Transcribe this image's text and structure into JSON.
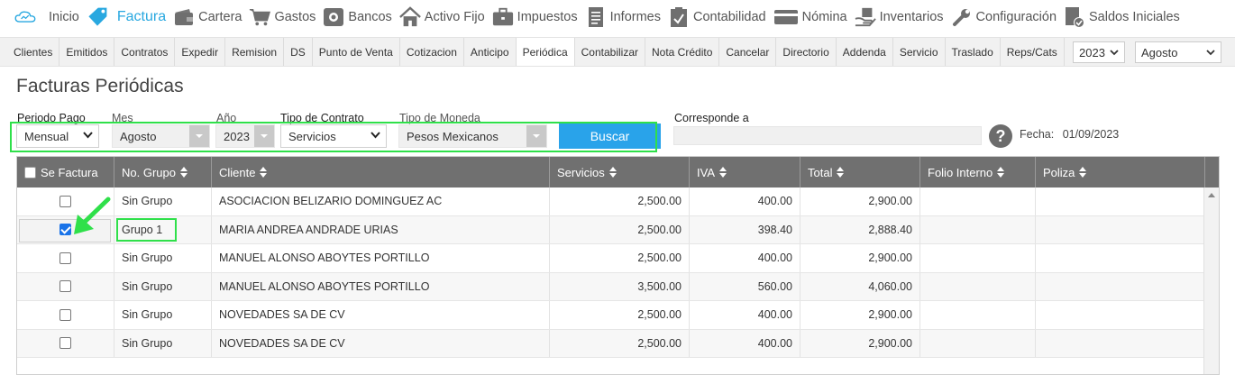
{
  "topnav": {
    "items": [
      {
        "label": "Inicio",
        "icon": "cloud-icon"
      },
      {
        "label": "Factura",
        "icon": "tag-icon"
      },
      {
        "label": "Cartera",
        "icon": "wallet-icon"
      },
      {
        "label": "Gastos",
        "icon": "cart-icon"
      },
      {
        "label": "Bancos",
        "icon": "bank-icon"
      },
      {
        "label": "Activo Fijo",
        "icon": "house-icon"
      },
      {
        "label": "Impuestos",
        "icon": "briefcase-icon"
      },
      {
        "label": "Informes",
        "icon": "document-icon"
      },
      {
        "label": "Contabilidad",
        "icon": "clipboard-check-icon"
      },
      {
        "label": "Nómina",
        "icon": "card-icon"
      },
      {
        "label": "Inventarios",
        "icon": "hand-box-icon"
      },
      {
        "label": "Configuración",
        "icon": "wrench-icon"
      },
      {
        "label": "Saldos Iniciales",
        "icon": "document-check-icon"
      }
    ],
    "active_index": 1
  },
  "subnav": {
    "tabs": [
      "Clientes",
      "Emitidos",
      "Contratos",
      "Expedir",
      "Remision",
      "DS",
      "Punto de Venta",
      "Cotizacion",
      "Anticipo",
      "Periódica",
      "Contabilizar",
      "Nota Crédito",
      "Cancelar",
      "Directorio",
      "Addenda",
      "Servicio",
      "Traslado",
      "Reps/Cats"
    ],
    "active_index": 9,
    "year": "2023",
    "month": "Agosto"
  },
  "page_title": "Facturas Periódicas",
  "filters": {
    "periodo_pago": {
      "label": "Periodo Pago",
      "value": "Mensual"
    },
    "mes": {
      "label": "Mes",
      "value": "Agosto"
    },
    "anio": {
      "label": "Año",
      "value": "2023"
    },
    "tipo_contrato": {
      "label": "Tipo de Contrato",
      "value": "Servicios"
    },
    "tipo_moneda": {
      "label": "Tipo de Moneda",
      "value": "Pesos Mexicanos"
    },
    "buscar_label": "Buscar",
    "corresponde_label": "Corresponde a",
    "fecha_label": "Fecha:",
    "fecha_value": "01/09/2023"
  },
  "table": {
    "columns": [
      "Se Factura",
      "No. Grupo",
      "Cliente",
      "Servicios",
      "IVA",
      "Total",
      "Folio Interno",
      "Poliza"
    ],
    "rows": [
      {
        "checked": false,
        "grupo": "Sin Grupo",
        "cliente": "ASOCIACION BELIZARIO DOMINGUEZ AC",
        "servicios": "2,500.00",
        "iva": "400.00",
        "total": "2,900.00"
      },
      {
        "checked": true,
        "grupo": "Grupo 1",
        "cliente": "MARIA ANDREA ANDRADE URIAS",
        "servicios": "2,500.00",
        "iva": "398.40",
        "total": "2,888.40"
      },
      {
        "checked": false,
        "grupo": "Sin Grupo",
        "cliente": "MANUEL ALONSO ABOYTES PORTILLO",
        "servicios": "2,500.00",
        "iva": "400.00",
        "total": "2,900.00"
      },
      {
        "checked": false,
        "grupo": "Sin Grupo",
        "cliente": "MANUEL ALONSO ABOYTES PORTILLO",
        "servicios": "3,500.00",
        "iva": "560.00",
        "total": "4,060.00"
      },
      {
        "checked": false,
        "grupo": "Sin Grupo",
        "cliente": "NOVEDADES SA DE CV",
        "servicios": "2,500.00",
        "iva": "400.00",
        "total": "2,900.00"
      },
      {
        "checked": false,
        "grupo": "Sin Grupo",
        "cliente": "NOVEDADES SA DE CV",
        "servicios": "2,500.00",
        "iva": "400.00",
        "total": "2,900.00"
      }
    ]
  },
  "colors": {
    "accent": "#29a8e0",
    "button": "#29a3ea",
    "header_bg": "#707070",
    "highlight": "#2fe04a"
  }
}
